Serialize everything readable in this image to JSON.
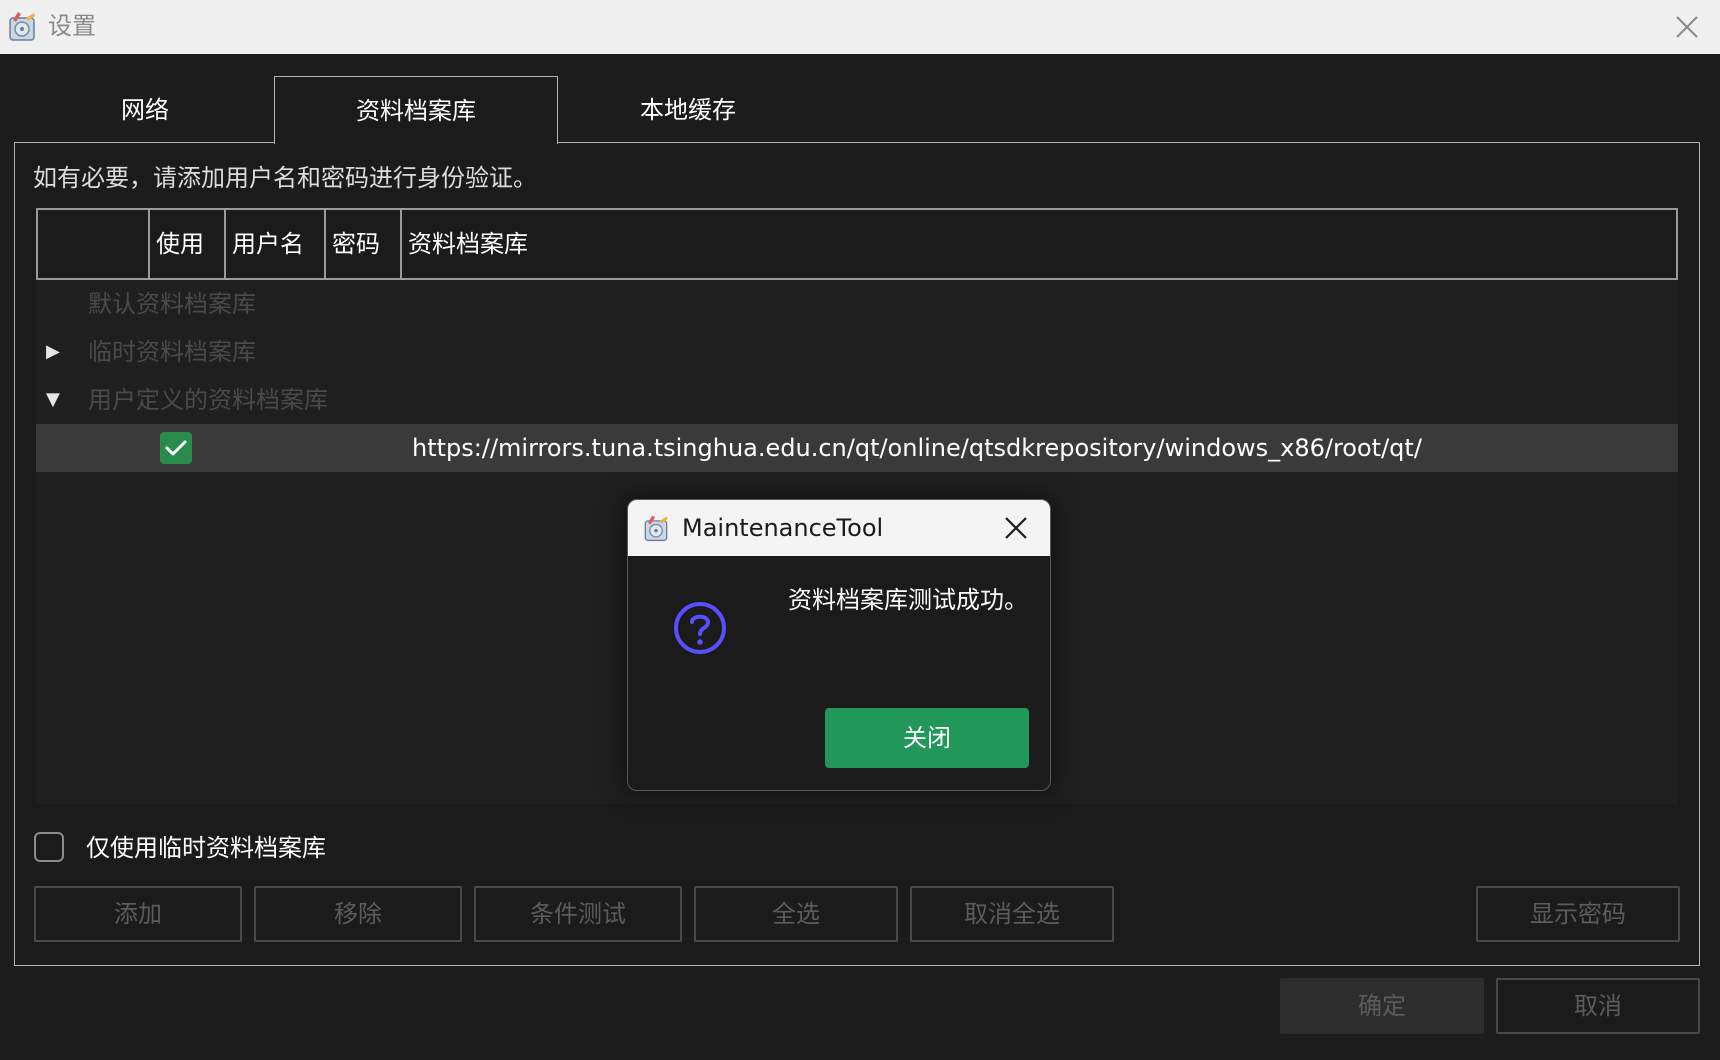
{
  "window": {
    "title": "设置"
  },
  "tabs": [
    {
      "label": "网络"
    },
    {
      "label": "资料档案库"
    },
    {
      "label": "本地缓存"
    }
  ],
  "hint": "如有必要，请添加用户名和密码进行身份验证。",
  "table": {
    "columns": [
      "使用",
      "用户名",
      "密码",
      "资料档案库"
    ]
  },
  "tree": {
    "default_repo": "默认资料档案库",
    "temp_repo": "临时资料档案库",
    "user_repo": "用户定义的资料档案库",
    "repo_url": "https://mirrors.tuna.tsinghua.edu.cn/qt/online/qtsdkrepository/windows_x86/root/qt/"
  },
  "only_temp_label": "仅使用临时资料档案库",
  "buttons": {
    "add": "添加",
    "remove": "移除",
    "test": "条件测试",
    "select_all": "全选",
    "deselect_all": "取消全选",
    "show_password": "显示密码",
    "ok": "确定",
    "cancel": "取消"
  },
  "dialog": {
    "title": "MaintenanceTool",
    "message": "资料档案库测试成功。",
    "close": "关闭"
  },
  "colors": {
    "accent_green": "#22975a",
    "check_green": "#2a8c4a",
    "question_blue": "#5a4fff"
  }
}
